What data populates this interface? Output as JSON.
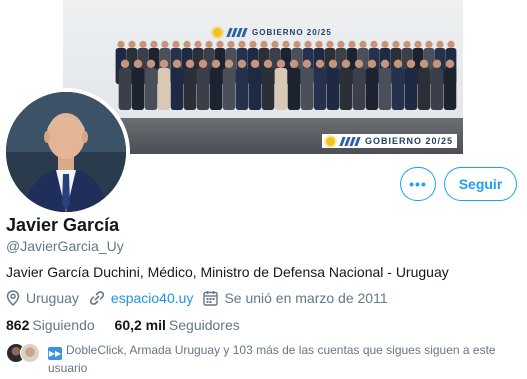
{
  "banner": {
    "brand_top": "GOBIERNO 20/25",
    "brand_bottom": "GOBIERNO 20/25"
  },
  "profile": {
    "name": "Javier García",
    "handle": "@JavierGarcia_Uy",
    "bio": "Javier García Duchini, Médico, Ministro de Defensa Nacional - Uruguay",
    "location": "Uruguay",
    "website": "espacio40.uy",
    "joined": "Se unió en marzo de 2011"
  },
  "actions": {
    "more_label": "•••",
    "follow_label": "Seguir"
  },
  "stats": {
    "following_value": "862",
    "following_label": "Siguiendo",
    "followers_value": "60,2 mil",
    "followers_label": "Seguidores"
  },
  "known_followers": {
    "text": "DobleClick, Armada Uruguay y 103 más de las cuentas que sigues siguen a este usuario"
  },
  "colors": {
    "accent": "#1da1f2",
    "link": "#1b95e0",
    "muted": "#657786"
  },
  "icons": [
    "location-icon",
    "link-icon",
    "calendar-icon",
    "more-icon",
    "fast-forward-icon"
  ]
}
